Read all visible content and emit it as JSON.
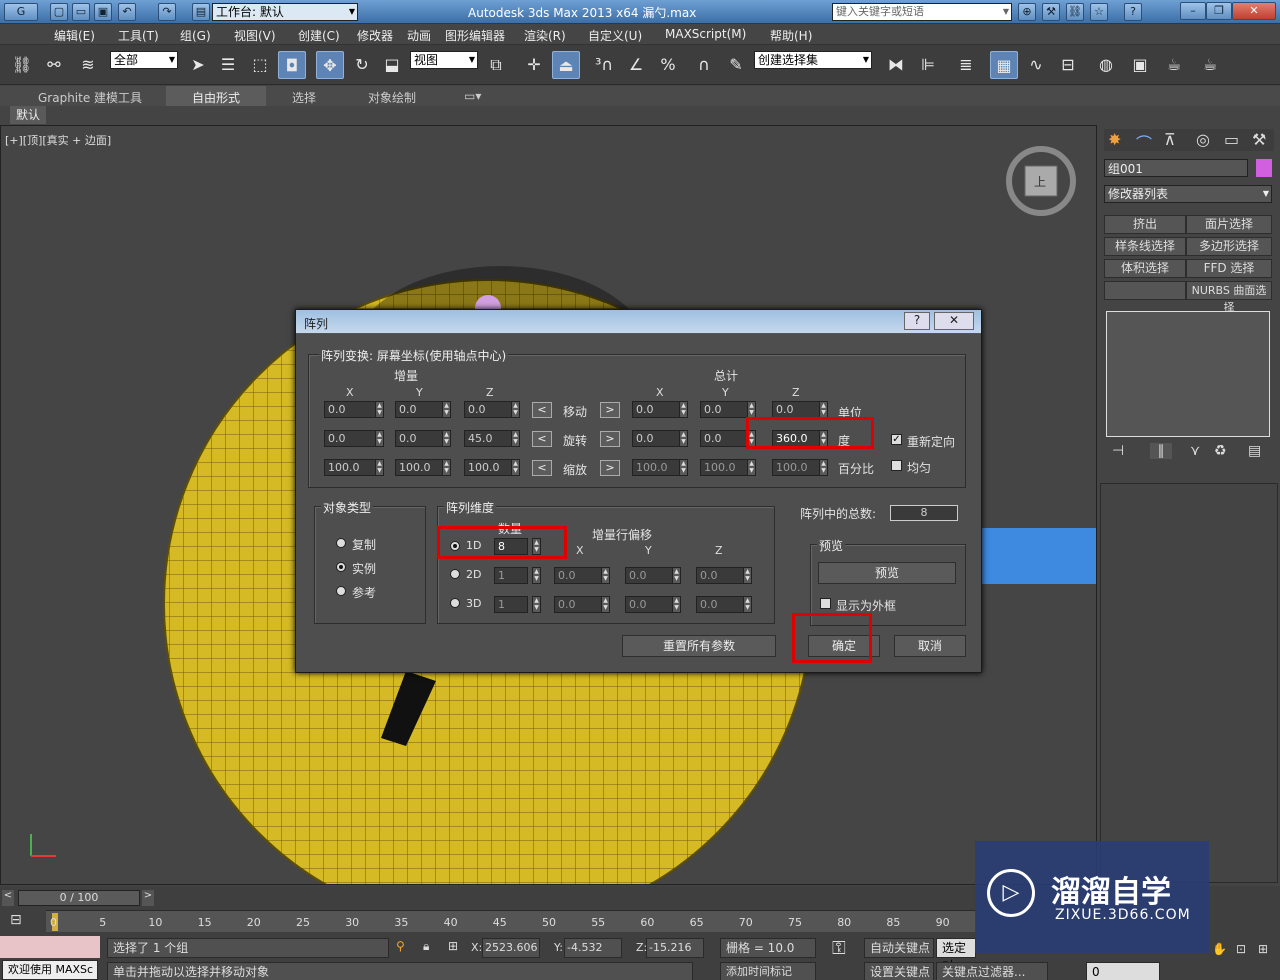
{
  "window": {
    "workspace_label": "工作台: 默认",
    "title": "Autodesk 3ds Max  2013 x64      漏勺.max",
    "search_placeholder": "键入关键字或短语"
  },
  "menu": [
    "编辑(E)",
    "工具(T)",
    "组(G)",
    "视图(V)",
    "创建(C)",
    "修改器",
    "动画",
    "图形编辑器",
    "渲染(R)",
    "自定义(U)",
    "MAXScript(M)",
    "帮助(H)"
  ],
  "toolbar": {
    "filter": "全部",
    "ref_coord": "视图",
    "selection_set": "创建选择集"
  },
  "ribbon": {
    "tabs": [
      "Graphite 建模工具",
      "自由形式",
      "选择",
      "对象绘制"
    ],
    "sub": "默认"
  },
  "viewport": {
    "label": "[+][顶][真实 + 边面]",
    "viewcube_face": "上"
  },
  "command_panel": {
    "object_name": "组001",
    "modifier_list": "修改器列表",
    "buttons": [
      "挤出",
      "面片选择",
      "样条线选择",
      "多边形选择",
      "体积选择",
      "FFD 选择",
      "",
      "NURBS 曲面选择"
    ]
  },
  "dialog": {
    "title": "阵列",
    "help": "?",
    "close": "✕",
    "transform_group": "阵列变换: 屏幕坐标(使用轴点中心)",
    "incremental": "增量",
    "totals": "总计",
    "axes": [
      "X",
      "Y",
      "Z"
    ],
    "rows": [
      {
        "label": "移动",
        "inc": [
          "0.0",
          "0.0",
          "0.0"
        ],
        "tot": [
          "0.0",
          "0.0",
          "0.0"
        ],
        "unit": "单位"
      },
      {
        "label": "旋转",
        "inc": [
          "0.0",
          "0.0",
          "45.0"
        ],
        "tot": [
          "0.0",
          "0.0",
          "360.0"
        ],
        "unit": "度"
      },
      {
        "label": "缩放",
        "inc": [
          "100.0",
          "100.0",
          "100.0"
        ],
        "tot": [
          "100.0",
          "100.0",
          "100.0"
        ],
        "unit": "百分比"
      }
    ],
    "arrow_left": "<",
    "arrow_right": ">",
    "reorient": "重新定向",
    "uniform": "均匀",
    "object_type": {
      "title": "对象类型",
      "options": [
        "复制",
        "实例",
        "参考"
      ],
      "selected": "实例"
    },
    "array_dims": {
      "title": "阵列维度",
      "count_label": "数量",
      "offset_label": "增量行偏移",
      "dims": [
        {
          "name": "1D",
          "count": "8"
        },
        {
          "name": "2D",
          "count": "1",
          "offsets": [
            "0.0",
            "0.0",
            "0.0"
          ]
        },
        {
          "name": "3D",
          "count": "1",
          "offsets": [
            "0.0",
            "0.0",
            "0.0"
          ]
        }
      ]
    },
    "total_label": "阵列中的总数:",
    "total_value": "8",
    "preview": {
      "title": "预览",
      "button": "预览",
      "show_as_box": "显示为外框"
    },
    "reset": "重置所有参数",
    "ok": "确定",
    "cancel": "取消"
  },
  "timeline": {
    "frame": "0 / 100",
    "ticks": [
      "0",
      "5",
      "10",
      "15",
      "20",
      "25",
      "30",
      "35",
      "40",
      "45",
      "50",
      "55",
      "60",
      "65",
      "70",
      "75",
      "80",
      "85",
      "90"
    ]
  },
  "status": {
    "selected": "选择了 1 个组",
    "prompt": "单击并拖动以选择并移动对象",
    "welcome": "欢迎使用 MAXSc",
    "x": "2523.606",
    "y": "-4.532",
    "z": "-15.216",
    "grid": "栅格 = 10.0",
    "auto_key": "自动关键点",
    "set_key": "设置关键点",
    "selected_obj": "选定对",
    "add_time_tag": "添加时间标记",
    "key_filter": "关键点过滤器...",
    "frame_field": "0"
  },
  "watermark": {
    "brand": "溜溜自学",
    "url": "ZIXUE.3D66.COM"
  }
}
